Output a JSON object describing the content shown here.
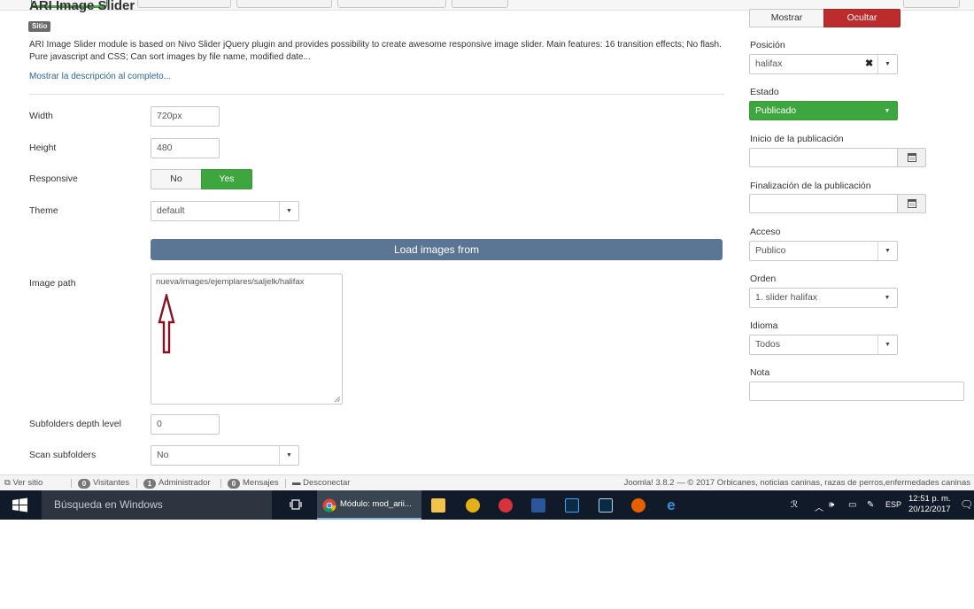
{
  "module": {
    "title": "ARI Image Slider",
    "badge": "Sitio",
    "description": "ARI Image Slider module is based on Nivo Slider jQuery plugin and provides possibility to create awesome responsive image slider. Main features: 16 transition effects; No flash. Pure javascript and CSS; Can sort images by file name, modified date...",
    "more_link": "Mostrar la descripción al completo..."
  },
  "form": {
    "width": {
      "label": "Width",
      "value": "720px"
    },
    "height": {
      "label": "Height",
      "value": "480"
    },
    "responsive": {
      "label": "Responsive",
      "options": [
        "No",
        "Yes"
      ],
      "selected": "Yes"
    },
    "theme": {
      "label": "Theme",
      "value": "default"
    },
    "load_images_from": "Load images from",
    "image_path": {
      "label": "Image path",
      "value": "nueva/images/ejemplares/saljelk/halifax"
    },
    "subfolders_depth": {
      "label": "Subfolders depth level",
      "value": "0"
    },
    "scan_subfolders": {
      "label": "Scan subfolders",
      "value": "No"
    }
  },
  "sidebar": {
    "show_title": {
      "options": [
        "Mostrar",
        "Ocultar"
      ],
      "selected": "Ocultar"
    },
    "position": {
      "label": "Posición",
      "value": "halifax"
    },
    "status": {
      "label": "Estado",
      "value": "Publicado"
    },
    "publish_up": {
      "label": "Inicio de la publicación",
      "value": ""
    },
    "publish_down": {
      "label": "Finalización de la publicación",
      "value": ""
    },
    "access": {
      "label": "Acceso",
      "value": "Publico"
    },
    "ordering": {
      "label": "Orden",
      "value": "1. slider halifax"
    },
    "language": {
      "label": "Idioma",
      "value": "Todos"
    },
    "note": {
      "label": "Nota",
      "value": ""
    }
  },
  "status_bar": {
    "view_site": "Ver sitio",
    "visitors": {
      "count": "0",
      "label": "Visitantes"
    },
    "admins": {
      "count": "1",
      "label": "Administrador"
    },
    "messages": {
      "count": "0",
      "label": "Mensajes"
    },
    "logout": "Desconectar",
    "footer": "Joomla! 3.8.2 — © 2017 Orbicanes, noticias caninas, razas de perros,enfermedades caninas"
  },
  "taskbar": {
    "search_placeholder": "Búsqueda en Windows",
    "active_task": "Módulo: mod_arii...",
    "language": "ESP",
    "time": "12:51 p. m.",
    "date": "20/12/2017"
  },
  "colors": {
    "green": "#3ea63e",
    "red": "#bd2c2c",
    "load_bar": "#5a7694",
    "annotation_arrow": "#8a1020",
    "taskbar": "#101a28"
  }
}
